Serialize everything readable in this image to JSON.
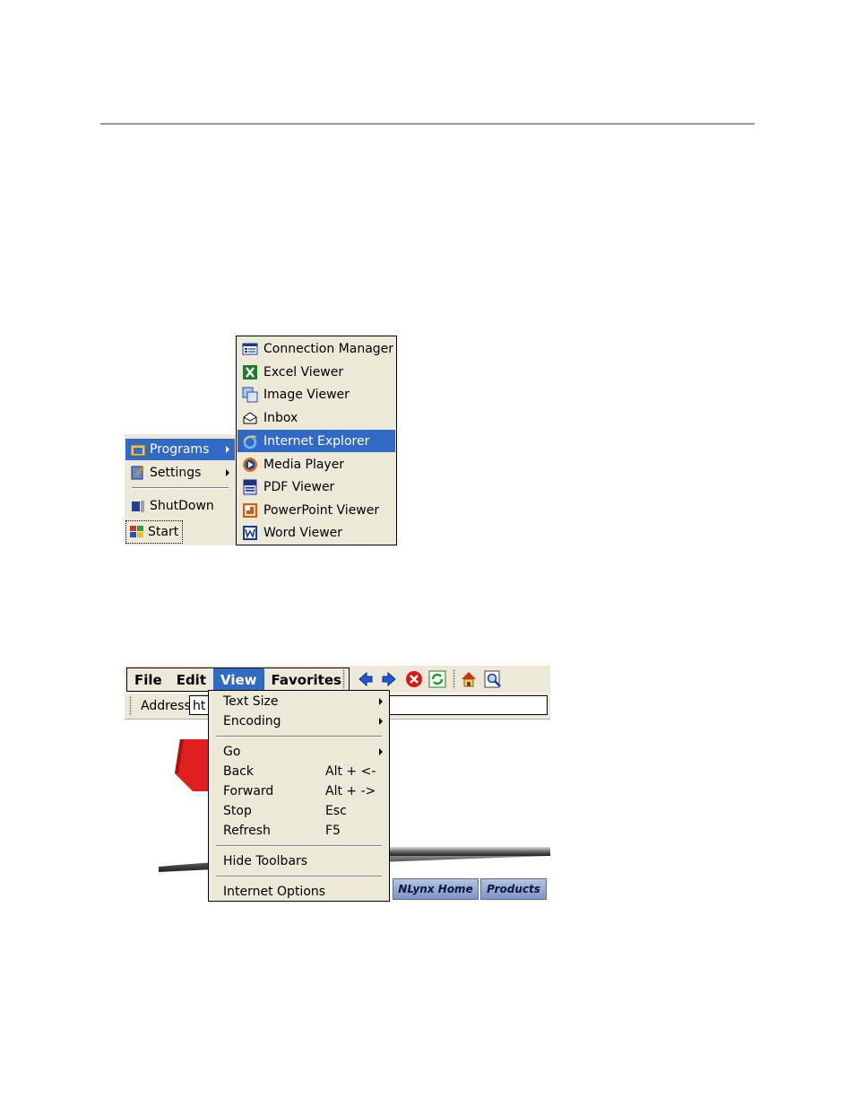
{
  "start_menu": {
    "items": [
      {
        "label": "Programs",
        "icon": "programs-folder-icon"
      },
      {
        "label": "Settings",
        "icon": "settings-icon"
      },
      {
        "label": "ShutDown",
        "icon": "shutdown-icon"
      }
    ],
    "start_label": "Start"
  },
  "programs_menu": {
    "items": [
      {
        "label": "Connection Manager",
        "icon": "connection-manager-icon"
      },
      {
        "label": "Excel Viewer",
        "icon": "excel-icon"
      },
      {
        "label": "Image Viewer",
        "icon": "image-viewer-icon"
      },
      {
        "label": "Inbox",
        "icon": "inbox-icon"
      },
      {
        "label": "Internet Explorer",
        "icon": "internet-explorer-icon"
      },
      {
        "label": "Media Player",
        "icon": "media-player-icon"
      },
      {
        "label": "PDF Viewer",
        "icon": "pdf-icon"
      },
      {
        "label": "PowerPoint Viewer",
        "icon": "powerpoint-icon"
      },
      {
        "label": "Word Viewer",
        "icon": "word-icon"
      }
    ]
  },
  "browser": {
    "menubar": [
      "File",
      "Edit",
      "View",
      "Favorites"
    ],
    "toolbar_icons": [
      "back-icon",
      "forward-icon",
      "stop-icon",
      "refresh-icon",
      "home-icon",
      "search-icon"
    ],
    "address_label": "Address",
    "address_value": "ht",
    "nav_buttons": [
      "NLynx Home",
      "Products"
    ],
    "view_menu": {
      "text_size": "Text Size",
      "encoding": "Encoding",
      "go": "Go",
      "back": "Back",
      "back_key": "Alt + <-",
      "forward": "Forward",
      "forward_key": "Alt + ->",
      "stop": "Stop",
      "stop_key": "Esc",
      "refresh": "Refresh",
      "refresh_key": "F5",
      "hide_toolbars": "Hide Toolbars",
      "internet_options": "Internet Options"
    }
  },
  "colors": {
    "menu_bg": "#ece9d8",
    "highlight": "#316ac5"
  }
}
